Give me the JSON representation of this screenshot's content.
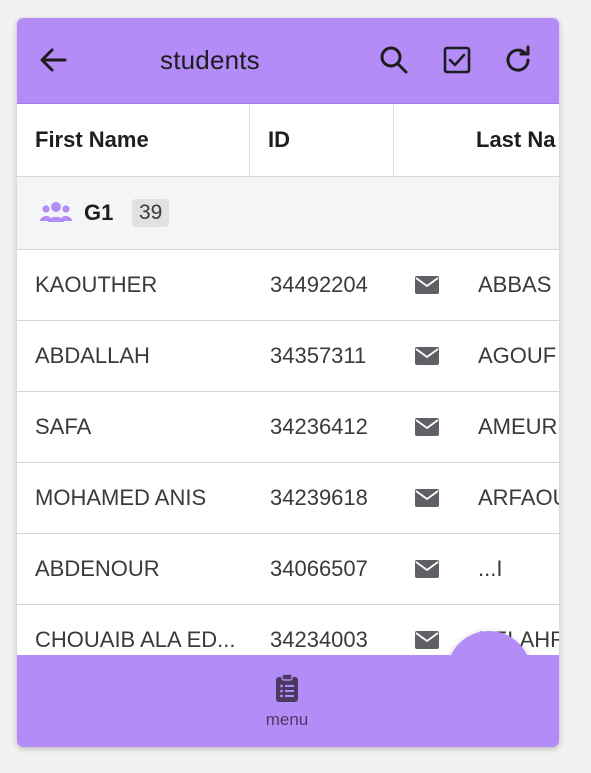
{
  "header": {
    "title": "students",
    "back_icon": "arrow-left-icon",
    "actions": [
      "search-icon",
      "checkbox-icon",
      "refresh-icon"
    ]
  },
  "table": {
    "columns": [
      "First Name",
      "ID",
      "",
      "Last Na"
    ],
    "group": {
      "name": "G1",
      "count": "39",
      "icon": "users-icon"
    },
    "rows": [
      {
        "first_name": "KAOUTHER",
        "id": "34492204",
        "last_name": "ABBAS"
      },
      {
        "first_name": "ABDALLAH",
        "id": "34357311",
        "last_name": "AGOUF"
      },
      {
        "first_name": "SAFA",
        "id": "34236412",
        "last_name": "AMEUR"
      },
      {
        "first_name": "MOHAMED ANIS",
        "id": "34239618",
        "last_name": "ARFAOU"
      },
      {
        "first_name": "ABDENOUR",
        "id": "34066507",
        "last_name": "...I"
      },
      {
        "first_name": "CHOUAIB ALA ED...",
        "id": "34234003",
        "last_name": "BELAHR"
      }
    ]
  },
  "fab": {
    "icon": "plus-icon"
  },
  "bottom_nav": {
    "items": [
      {
        "label": "menu",
        "icon": "clipboard-list-icon"
      }
    ]
  },
  "colors": {
    "accent": "#b38cf8",
    "group_icon": "#b38cf8",
    "mail_icon": "#5f5f66"
  }
}
